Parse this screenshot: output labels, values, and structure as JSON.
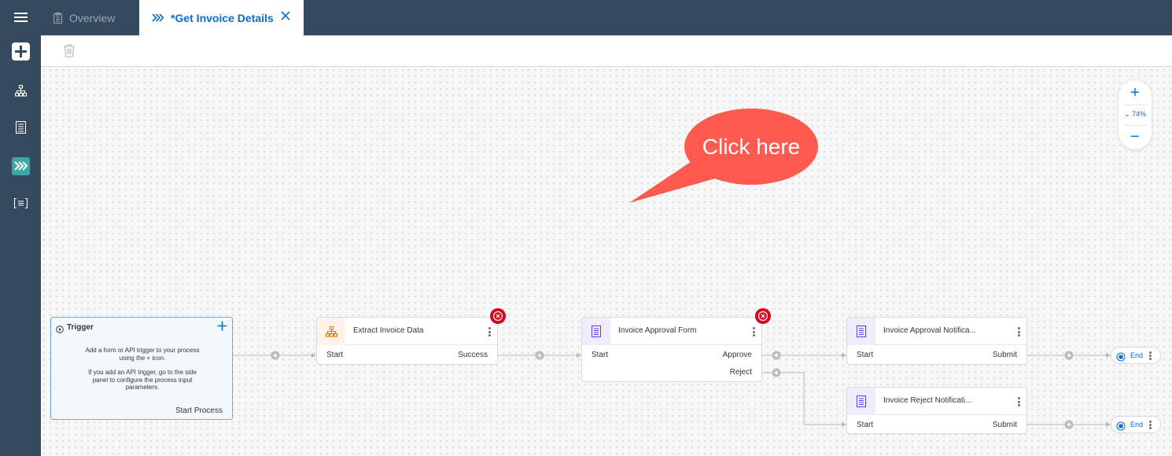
{
  "tabs": [
    {
      "label": "Overview",
      "icon": "clipboard-icon",
      "active": false
    },
    {
      "label": "*Get Invoice Details",
      "icon": "process-chevrons-icon",
      "active": true
    }
  ],
  "zoom": {
    "level": "74%"
  },
  "callout": {
    "text": "Click here",
    "color": "#ff5a4f"
  },
  "trigger": {
    "title": "Trigger",
    "line1": "Add a form or API trigger to your process using the + icon.",
    "line2": "If you add an API trigger, go to the side panel to configure the process input parameters.",
    "output": "Start Process"
  },
  "nodes": {
    "extract": {
      "title": "Extract Invoice Data",
      "input": "Start",
      "outputs": [
        "Success"
      ]
    },
    "approval_form": {
      "title": "Invoice Approval Form",
      "input": "Start",
      "outputs": [
        "Approve",
        "Reject"
      ]
    },
    "approval_notification": {
      "title": "Invoice Approval Notifica...",
      "input": "Start",
      "outputs": [
        "Submit"
      ]
    },
    "reject_notification": {
      "title": "Invoice Reject Notificati...",
      "input": "Start",
      "outputs": [
        "Submit"
      ]
    }
  },
  "ends": [
    {
      "label": "End"
    },
    {
      "label": "End"
    }
  ],
  "colors": {
    "shell": "#354a5f",
    "accent": "#0a6ed1",
    "teal": "#3ea6a0",
    "error": "#d9001b",
    "automation": "#e9730c",
    "form": "#5d36ff"
  }
}
